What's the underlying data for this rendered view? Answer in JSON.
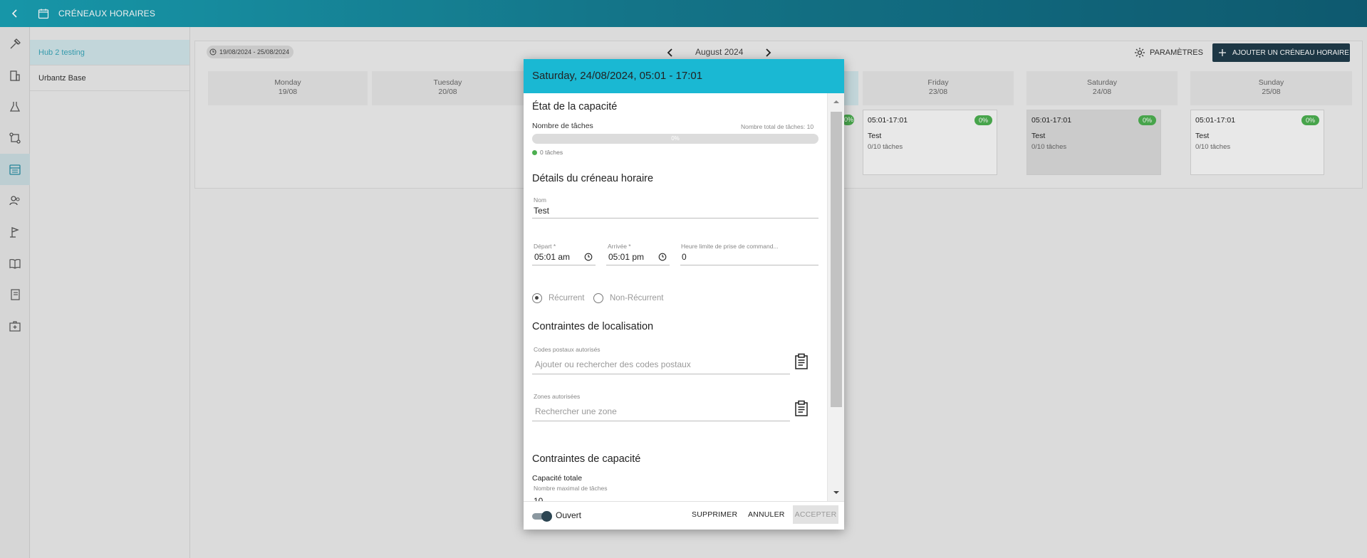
{
  "header": {
    "title": "CRÉNEAUX HORAIRES"
  },
  "hubs": [
    {
      "label": "Hub 2 testing",
      "active": true
    },
    {
      "label": "Urbantz Base",
      "active": false
    }
  ],
  "toolbar": {
    "date_range": "19/08/2024 - 25/08/2024",
    "month": "August 2024",
    "settings_label": "PARAMÈTRES",
    "add_label": "AJOUTER UN CRÉNEAU HORAIRE"
  },
  "days": [
    {
      "name": "Monday",
      "date": "19/08"
    },
    {
      "name": "Tuesday",
      "date": "20/08"
    },
    {
      "name": "Friday",
      "date": "23/08"
    },
    {
      "name": "Saturday",
      "date": "24/08"
    },
    {
      "name": "Sunday",
      "date": "25/08"
    }
  ],
  "slots": [
    {
      "time": "05:01-17:01",
      "badge": "0%",
      "name": "Test",
      "count": "0/10 tâches"
    },
    {
      "time": "05:01-17:01",
      "badge": "0%",
      "name": "Test",
      "count": "0/10 tâches"
    },
    {
      "time": "05:01-17:01",
      "badge": "0%",
      "name": "Test",
      "count": "0/10 tâches"
    }
  ],
  "partial_badge": "0%",
  "dialog": {
    "title": "Saturday, 24/08/2024, 05:01 - 17:01",
    "capacity": {
      "title": "État de la capacité",
      "tasks_label": "Nombre de tâches",
      "total_label": "Nombre total de tâches: 10",
      "progress_text": "0%",
      "progress": 0,
      "legend": "0 tâches"
    },
    "details": {
      "title": "Détails du créneau horaire",
      "name_label": "Nom",
      "name_value": "Test",
      "start_label": "Départ *",
      "start_value": "05:01 am",
      "end_label": "Arrivée *",
      "end_value": "05:01 pm",
      "cutoff_label": "Heure limite de prise de command...",
      "cutoff_value": "0",
      "recurrent_label": "Récurrent",
      "nonrecurrent_label": "Non-Récurrent"
    },
    "location": {
      "title": "Contraintes de localisation",
      "postal_label": "Codes postaux autorisés",
      "postal_placeholder": "Ajouter ou rechercher des codes postaux",
      "zones_label": "Zones autorisées",
      "zones_placeholder": "Rechercher une zone"
    },
    "capacity_constraints": {
      "title": "Contraintes de capacité",
      "total_label": "Capacité totale",
      "max_label": "Nombre maximal de tâches",
      "max_value": "10"
    },
    "footer": {
      "open_label": "Ouvert",
      "delete_label": "SUPPRIMER",
      "cancel_label": "ANNULER",
      "accept_label": "ACCEPTER"
    }
  }
}
